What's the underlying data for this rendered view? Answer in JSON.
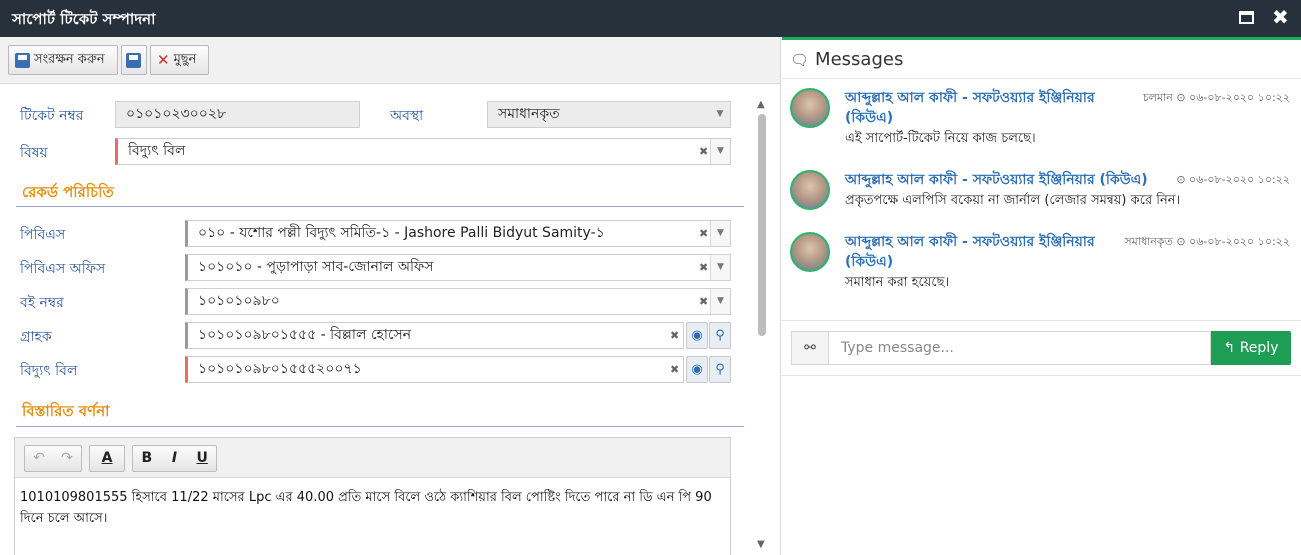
{
  "window": {
    "title": "সাপোর্ট টিকেট সম্পাদনা"
  },
  "toolbar": {
    "save_label": "সংরক্ষন করুন",
    "delete_label": "মুছুন"
  },
  "form": {
    "ticket_no_label": "টিকেট নম্বর",
    "ticket_no_value": "০১০১০২৩০০২৮",
    "status_label": "অবস্থা",
    "status_value": "সমাধানকৃত",
    "subject_label": "বিষয়",
    "subject_value": "বিদ্যুৎ বিল",
    "section_record": "রেকর্ড পরিচিতি",
    "pbs_label": "পিবিএস",
    "pbs_value": "০১০ - যশোর পল্লী বিদ্যুৎ সমিতি-১ - Jashore Palli Bidyut Samity-১",
    "pbs_office_label": "পিবিএস অফিস",
    "pbs_office_value": "১০১০১০ - পুড়াপাড়া সাব-জোনাল অফিস",
    "book_label": "বই নম্বর",
    "book_value": "১০১০১০৯৮০",
    "customer_label": "গ্রাহক",
    "customer_value": "১০১০১০৯৮০১৫৫৫ - বিল্লাল হোসেন",
    "bill_label": "বিদ্যুৎ বিল",
    "bill_value": "১০১০১০৯৮০১৫৫৫২০০৭১",
    "section_detail": "বিস্তারিত বর্ণনা"
  },
  "editor": {
    "btn_bold": "B",
    "btn_italic": "I",
    "btn_underline": "U",
    "btn_font": "A",
    "text": "1010109801555 হিসাবে 11/22 মাসের   Lpc এর  40.00  প্রতি মাসে বিলে ওঠে  ক্যাশিয়ার বিল পোষ্টিং দিতে পারে না  ডি এন পি 90 দিনে  চলে আসে।"
  },
  "messages": {
    "header": "Messages",
    "items": [
      {
        "author": "আব্দুল্লাহ আল কাফী - সফটওয়্যার ইঞ্জিনিয়ার (কিউএ)",
        "status": "চলমান",
        "time": "০৬-০৮-২০২০ ১০:২২",
        "text": "এই সাপোর্ট-টিকেট নিয়ে কাজ চলছে।"
      },
      {
        "author": "আব্দুল্লাহ আল কাফী - সফটওয়্যার ইঞ্জিনিয়ার (কিউএ)",
        "status": "",
        "time": "০৬-০৮-২০২০ ১০:২২",
        "text": "প্রকৃতপক্ষে এলপিসি বকেয়া না জার্নাল (লেজার সমন্বয়) করে নিন।"
      },
      {
        "author": "আব্দুল্লাহ আল কাফী - সফটওয়্যার ইঞ্জিনিয়ার (কিউএ)",
        "status": "সমাধানকৃত",
        "time": "০৬-০৮-২০২০ ১০:২২",
        "text": "সমাধান করা হয়েছে।"
      }
    ],
    "input_placeholder": "Type message...",
    "reply_label": "Reply"
  },
  "icons": {
    "maximize": "maximize-icon",
    "close": "close-icon",
    "save": "save-icon",
    "delete": "delete-icon",
    "clock": "clock-icon",
    "comments": "comments-icon",
    "link": "link-icon",
    "eye": "eye-icon",
    "search": "search-icon"
  },
  "colors": {
    "titlebar": "#26313c",
    "accent": "#1eaa5a",
    "label": "#2c55a0",
    "section": "#e09111",
    "reply": "#1e9e55",
    "author": "#2c6fb6"
  }
}
